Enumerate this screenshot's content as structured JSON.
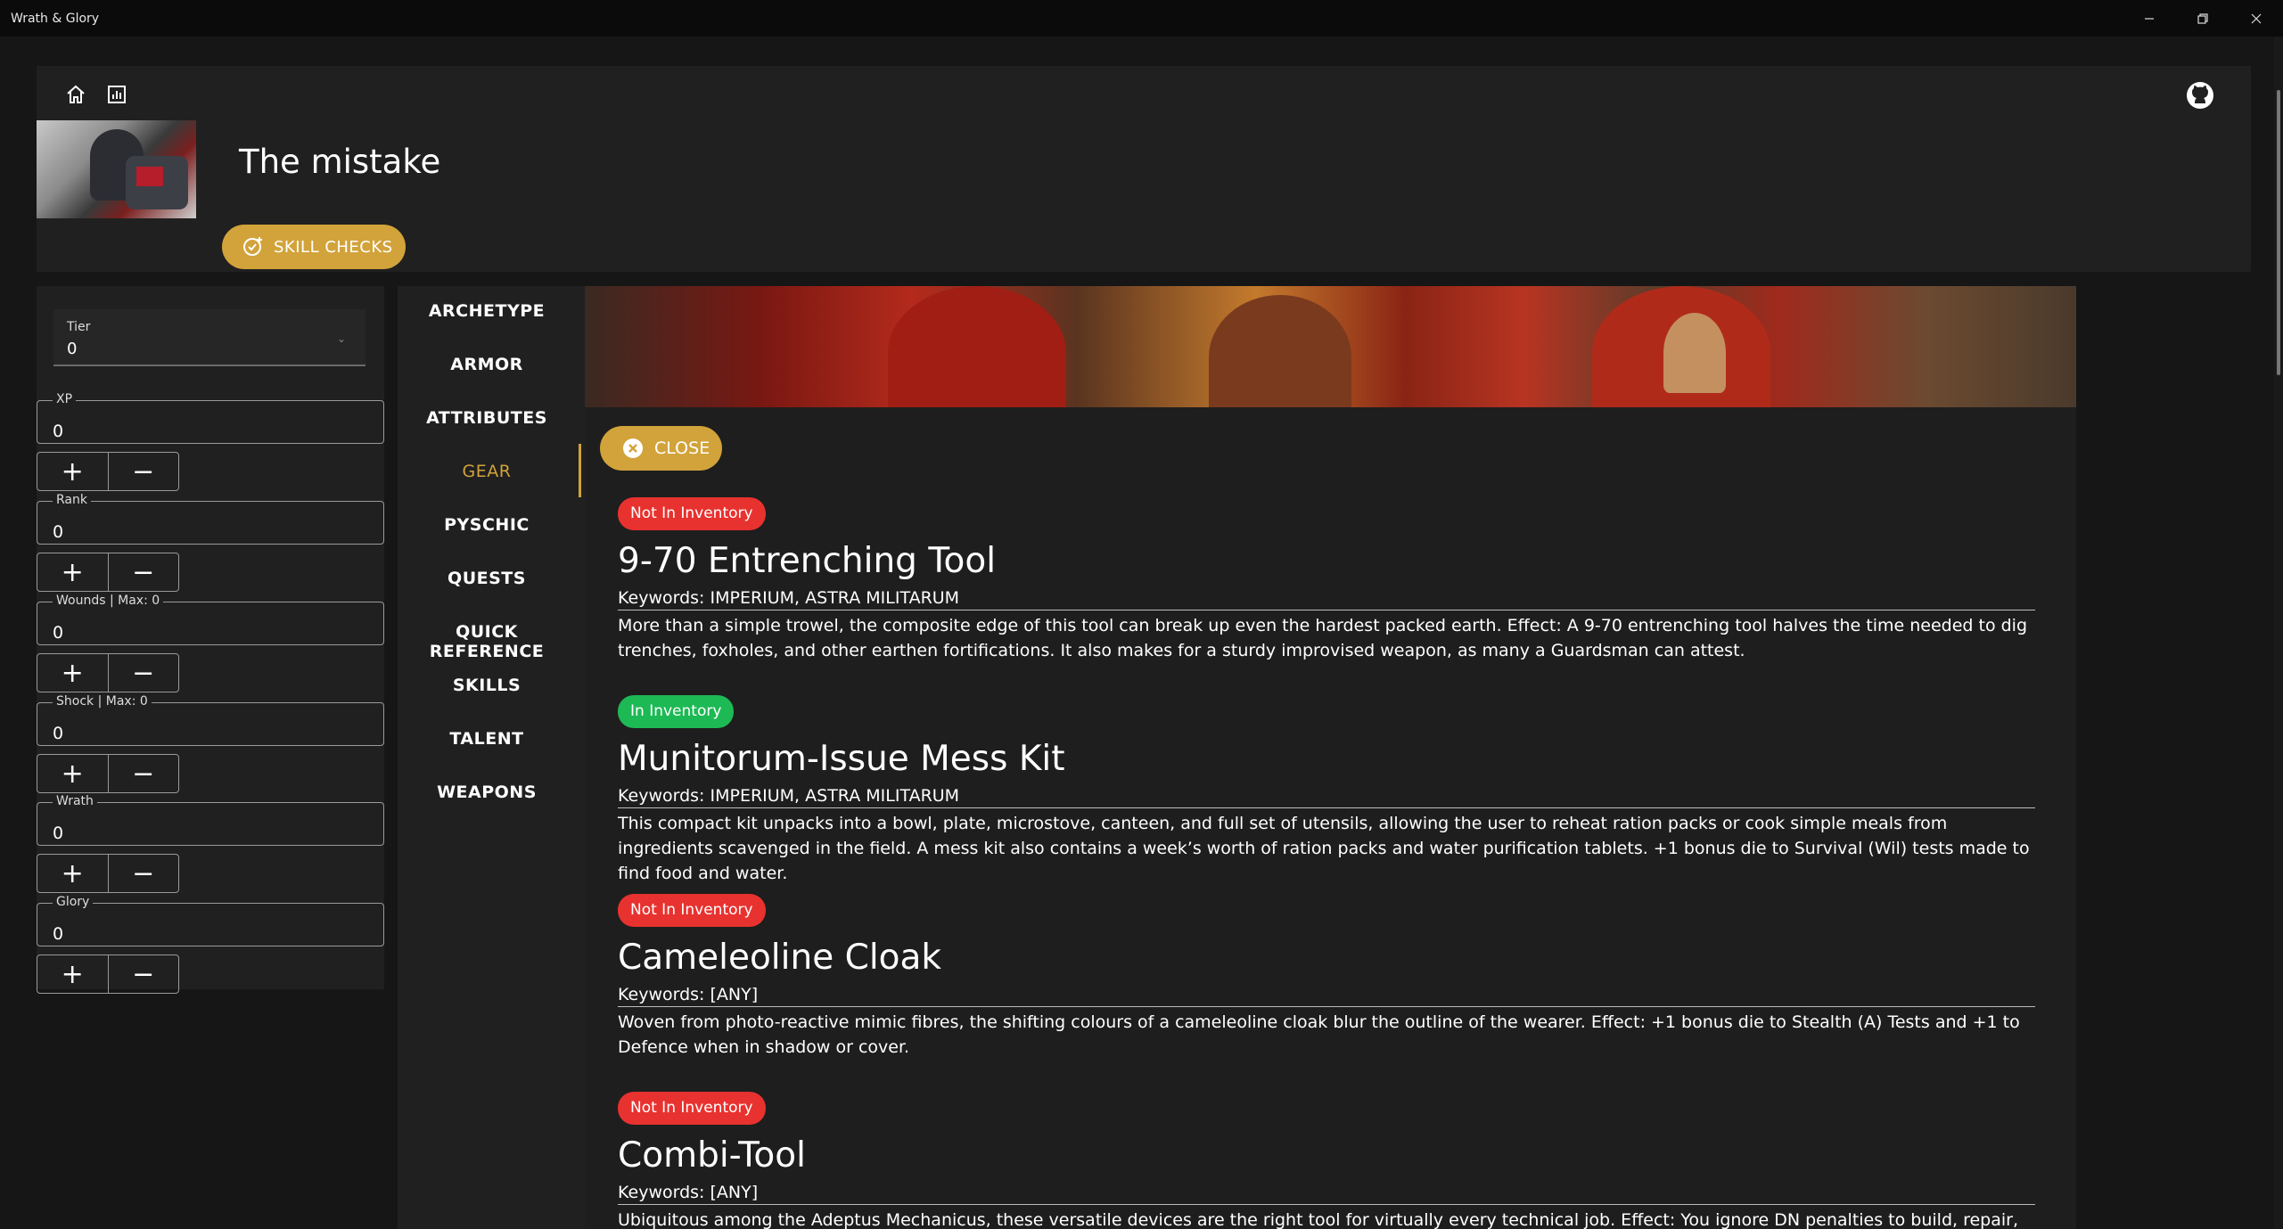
{
  "window": {
    "title": "Wrath & Glory",
    "controls": [
      "minimize",
      "restore",
      "close"
    ]
  },
  "header": {
    "character_name": "The mistake",
    "skill_checks_label": "SKILL CHECKS",
    "icons": [
      "home-icon",
      "stats-icon",
      "github-icon"
    ]
  },
  "stats": {
    "tier": {
      "label": "Tier",
      "value": "0"
    },
    "fields": [
      {
        "label": "XP",
        "value": "0"
      },
      {
        "label": "Rank",
        "value": "0"
      },
      {
        "label": "Wounds | Max: 0",
        "value": "0"
      },
      {
        "label": "Shock | Max: 0",
        "value": "0"
      },
      {
        "label": "Wrath",
        "value": "0"
      },
      {
        "label": "Glory",
        "value": "0"
      }
    ],
    "plus": "+",
    "minus": "−"
  },
  "nav": {
    "items": [
      "ARCHETYPE",
      "ARMOR",
      "ATTRIBUTES",
      "GEAR",
      "PYSCHIC",
      "QUESTS",
      "QUICK REFERENCE",
      "SKILLS",
      "TALENT",
      "WEAPONS"
    ],
    "active": "GEAR"
  },
  "content": {
    "close_label": "CLOSE",
    "gear": [
      {
        "badge": "Not In Inventory",
        "in_inventory": false,
        "name": "9-70 Entrenching Tool",
        "keywords": "Keywords: IMPERIUM, ASTRA MILITARUM",
        "description": "More than a simple trowel, the composite edge of this tool can break up even the hardest packed earth. Effect: A 9-70 entrenching tool halves the time needed to dig trenches, foxholes, and other earthen fortifications. It also makes for a sturdy improvised weapon, as many a Guardsman can attest."
      },
      {
        "badge": "In Inventory",
        "in_inventory": true,
        "name": "Munitorum-Issue Mess Kit",
        "keywords": "Keywords: IMPERIUM, ASTRA MILITARUM",
        "description": "This compact kit unpacks into a bowl, plate, microstove, canteen, and full set of utensils, allowing the user to reheat ration packs or cook simple meals from ingredients scavenged in the field. A mess kit also contains a week’s worth of ration packs and water purification tablets. +1 bonus die to Survival (Wil) tests made to find food and water."
      },
      {
        "badge": "Not In Inventory",
        "in_inventory": false,
        "name": "Cameleoline Cloak",
        "keywords": "Keywords: [ANY]",
        "description": "Woven from photo-reactive mimic fibres, the shifting colours of a cameleoline cloak blur the outline of the wearer. Effect: +1 bonus die to Stealth (A) Tests and +1 to Defence when in shadow or cover."
      },
      {
        "badge": "Not In Inventory",
        "in_inventory": false,
        "name": "Combi-Tool",
        "keywords": "Keywords: [ANY]",
        "description": "Ubiquitous among the Adeptus Mechanicus, these versatile devices are the right tool for virtually every technical job. Effect: You ignore DN penalties to build, repair, maintain,"
      }
    ]
  },
  "colors": {
    "accent": "#d2a33a",
    "not_in_inventory": "#e8322f",
    "in_inventory": "#1db954",
    "panel": "#202020"
  }
}
